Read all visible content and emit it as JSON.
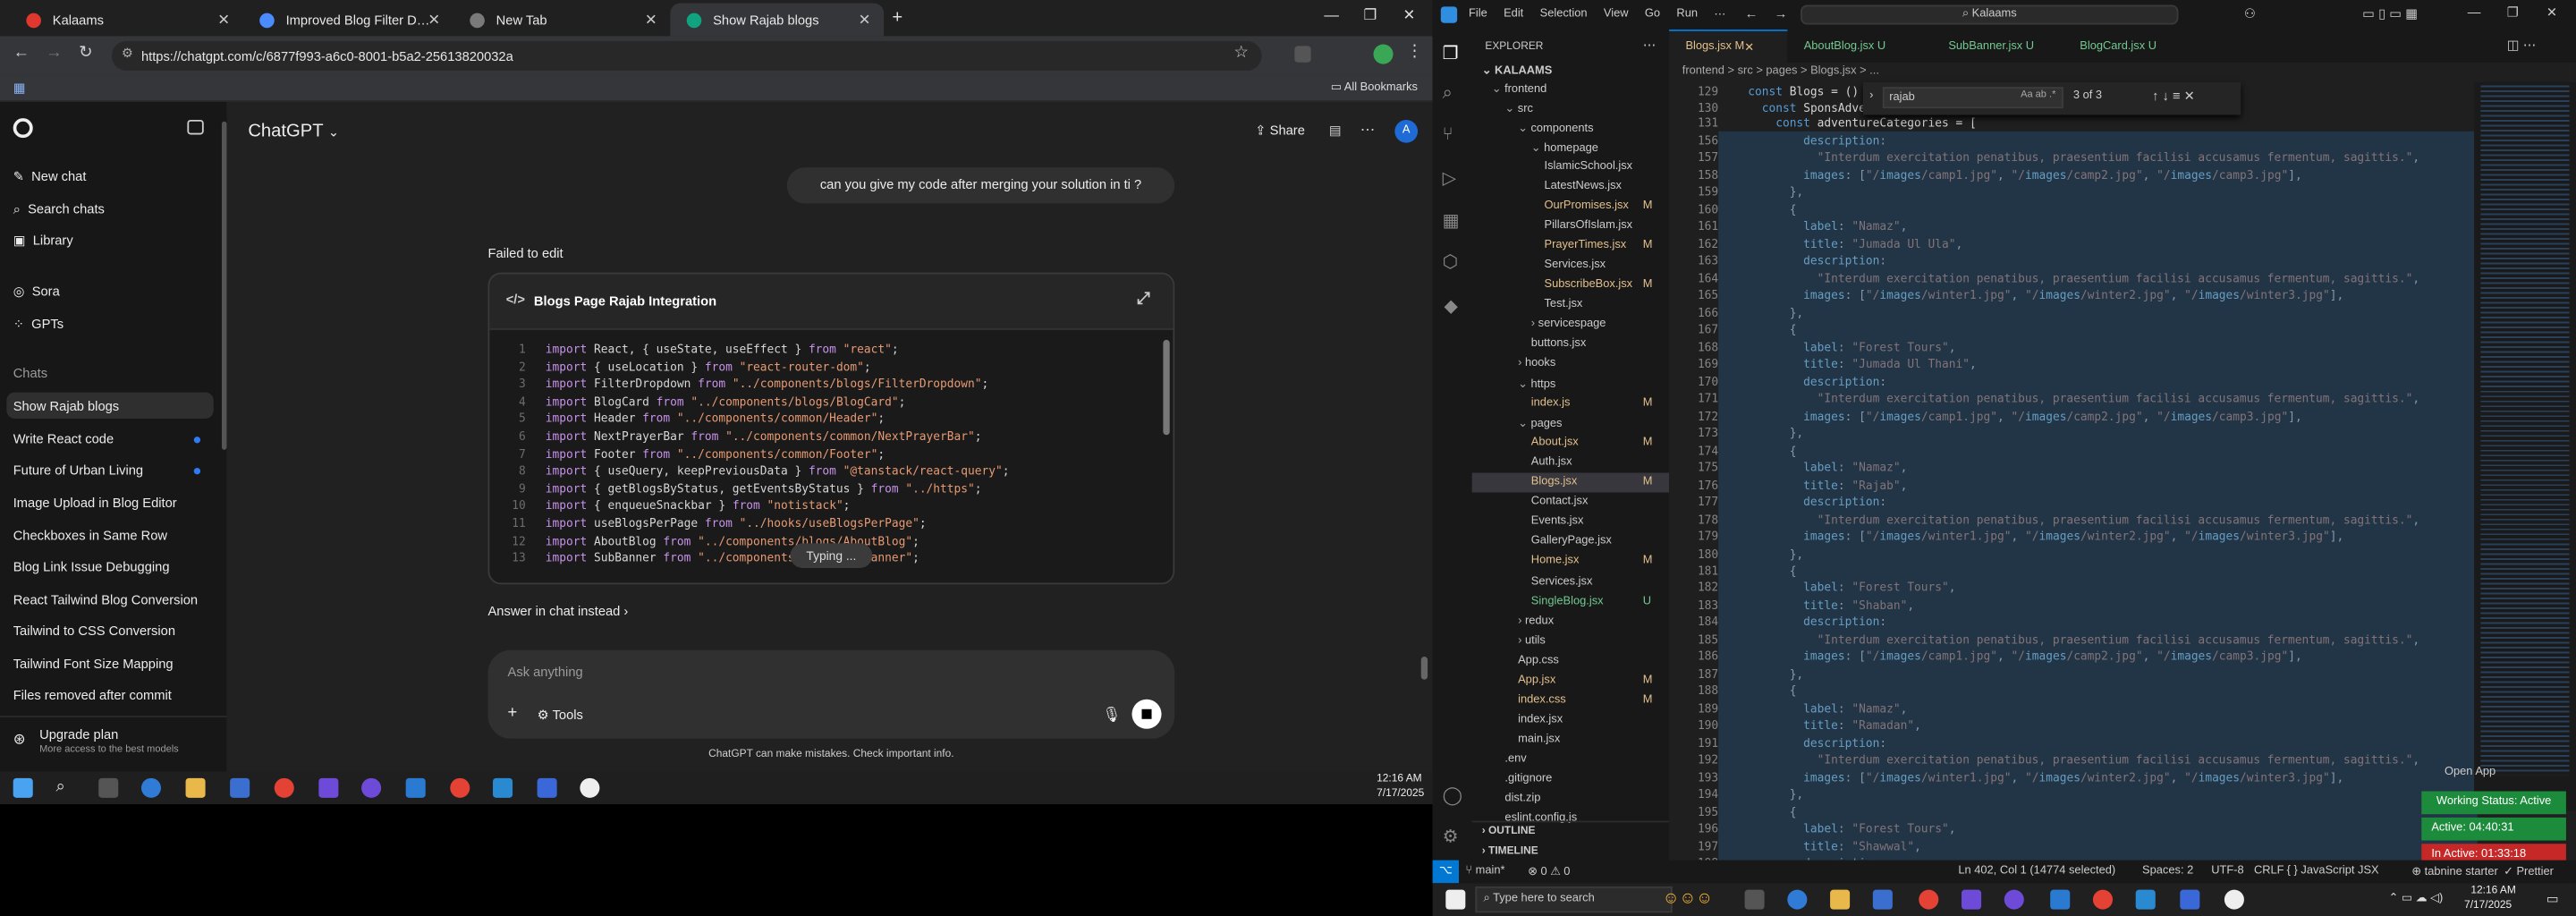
{
  "browser": {
    "tabs": [
      {
        "label": "Kalaams",
        "color": "#e0372f"
      },
      {
        "label": "Improved Blog Filter Dropdown",
        "color": "#4a8cff"
      },
      {
        "label": "New Tab",
        "color": "#7a7a7a"
      },
      {
        "label": "Show Rajab blogs",
        "color": "#10a37f"
      }
    ],
    "url": "https://chatgpt.com/c/6877f993-a6c0-8001-b5a2-25613820032a",
    "all_bookmarks": "All Bookmarks"
  },
  "chatgpt": {
    "brand": "ChatGPT",
    "share": "Share",
    "avatar": "A",
    "new_chat": "New chat",
    "search_chats": "Search chats",
    "library": "Library",
    "sora": "Sora",
    "gpts": "GPTs",
    "chats_header": "Chats",
    "chats": [
      "Show Rajab blogs",
      "Write React code",
      "Future of Urban Living",
      "Image Upload in Blog Editor",
      "Checkboxes in Same Row",
      "Blog Link Issue Debugging",
      "React Tailwind Blog Conversion",
      "Tailwind to CSS Conversion",
      "Tailwind Font Size Mapping",
      "Files removed after commit"
    ],
    "upgrade_title": "Upgrade plan",
    "upgrade_sub": "More access to the best models",
    "user_message": "can you give my code after merging your solution in ti ?",
    "failed": "Failed to edit",
    "canvas_title": "Blogs Page Rajab Integration",
    "code_lines": [
      [
        "1",
        "import React, { useState, useEffect } from \"react\";"
      ],
      [
        "2",
        "import { useLocation } from \"react-router-dom\";"
      ],
      [
        "3",
        "import FilterDropdown from \"../components/blogs/FilterDropdown\";"
      ],
      [
        "4",
        "import BlogCard from \"../components/blogs/BlogCard\";"
      ],
      [
        "5",
        "import Header from \"../components/common/Header\";"
      ],
      [
        "6",
        "import NextPrayerBar from \"../components/common/NextPrayerBar\";"
      ],
      [
        "7",
        "import Footer from \"../components/common/Footer\";"
      ],
      [
        "8",
        "import { useQuery, keepPreviousData } from \"@tanstack/react-query\";"
      ],
      [
        "9",
        "import { getBlogsByStatus, getEventsByStatus } from \"../https\";"
      ],
      [
        "10",
        "import { enqueueSnackbar } from \"notistack\";"
      ],
      [
        "11",
        "import useBlogsPerPage from \"../hooks/useBlogsPerPage\";"
      ],
      [
        "12",
        "import AboutBlog from \"../components/blogs/AboutBlog\";"
      ],
      [
        "13",
        "import SubBanner from \"../components/blogs/SubBanner\";"
      ]
    ],
    "typing": "Typing ...",
    "answer_in_chat": "Answer in chat instead",
    "input_placeholder": "Ask anything",
    "tools": "Tools",
    "disclaimer": "ChatGPT can make mistakes. Check important info."
  },
  "left_taskbar": {
    "time": "12:16 AM",
    "date": "7/17/2025"
  },
  "vscode": {
    "menu": [
      "File",
      "Edit",
      "Selection",
      "View",
      "Go",
      "Run"
    ],
    "search": "Kalaams",
    "explorer_title": "EXPLORER",
    "root": "KALAAMS",
    "tree": [
      {
        "name": "frontend",
        "indent": 1,
        "kind": "folder-open",
        "status": ""
      },
      {
        "name": "src",
        "indent": 2,
        "kind": "folder-open",
        "status": ""
      },
      {
        "name": "components",
        "indent": 3,
        "kind": "folder-open",
        "status": ""
      },
      {
        "name": "homepage",
        "indent": 4,
        "kind": "folder-open",
        "status": ""
      },
      {
        "name": "IslamicSchool.jsx",
        "indent": 5,
        "kind": "file",
        "status": ""
      },
      {
        "name": "LatestNews.jsx",
        "indent": 5,
        "kind": "file",
        "status": ""
      },
      {
        "name": "OurPromises.jsx",
        "indent": 5,
        "kind": "file",
        "status": "M"
      },
      {
        "name": "PillarsOfIslam.jsx",
        "indent": 5,
        "kind": "file",
        "status": ""
      },
      {
        "name": "PrayerTimes.jsx",
        "indent": 5,
        "kind": "file",
        "status": "M"
      },
      {
        "name": "Services.jsx",
        "indent": 5,
        "kind": "file",
        "status": ""
      },
      {
        "name": "SubscribeBox.jsx",
        "indent": 5,
        "kind": "file",
        "status": "M"
      },
      {
        "name": "Test.jsx",
        "indent": 5,
        "kind": "file",
        "status": ""
      },
      {
        "name": "servicespage",
        "indent": 4,
        "kind": "folder",
        "status": ""
      },
      {
        "name": "buttons.jsx",
        "indent": 4,
        "kind": "file",
        "status": ""
      },
      {
        "name": "hooks",
        "indent": 3,
        "kind": "folder",
        "status": ""
      },
      {
        "name": "https",
        "indent": 3,
        "kind": "folder-open",
        "status": ""
      },
      {
        "name": "index.js",
        "indent": 4,
        "kind": "file",
        "status": "M"
      },
      {
        "name": "pages",
        "indent": 3,
        "kind": "folder-open",
        "status": ""
      },
      {
        "name": "About.jsx",
        "indent": 4,
        "kind": "file",
        "status": "M"
      },
      {
        "name": "Auth.jsx",
        "indent": 4,
        "kind": "file",
        "status": ""
      },
      {
        "name": "Blogs.jsx",
        "indent": 4,
        "kind": "file",
        "status": "M"
      },
      {
        "name": "Contact.jsx",
        "indent": 4,
        "kind": "file",
        "status": ""
      },
      {
        "name": "Events.jsx",
        "indent": 4,
        "kind": "file",
        "status": ""
      },
      {
        "name": "GalleryPage.jsx",
        "indent": 4,
        "kind": "file",
        "status": ""
      },
      {
        "name": "Home.jsx",
        "indent": 4,
        "kind": "file",
        "status": "M"
      },
      {
        "name": "Services.jsx",
        "indent": 4,
        "kind": "file",
        "status": ""
      },
      {
        "name": "SingleBlog.jsx",
        "indent": 4,
        "kind": "file",
        "status": "U"
      },
      {
        "name": "redux",
        "indent": 3,
        "kind": "folder",
        "status": ""
      },
      {
        "name": "utils",
        "indent": 3,
        "kind": "folder",
        "status": ""
      },
      {
        "name": "App.css",
        "indent": 3,
        "kind": "file",
        "status": ""
      },
      {
        "name": "App.jsx",
        "indent": 3,
        "kind": "file",
        "status": "M"
      },
      {
        "name": "index.css",
        "indent": 3,
        "kind": "file",
        "status": "M"
      },
      {
        "name": "index.jsx",
        "indent": 3,
        "kind": "file",
        "status": ""
      },
      {
        "name": "main.jsx",
        "indent": 3,
        "kind": "file",
        "status": ""
      },
      {
        "name": ".env",
        "indent": 2,
        "kind": "file",
        "status": ""
      },
      {
        "name": ".gitignore",
        "indent": 2,
        "kind": "file",
        "status": ""
      },
      {
        "name": "dist.zip",
        "indent": 2,
        "kind": "file",
        "status": ""
      },
      {
        "name": "eslint.config.js",
        "indent": 2,
        "kind": "file",
        "status": ""
      }
    ],
    "outline": "OUTLINE",
    "timeline": "TIMELINE",
    "tabs": [
      {
        "label": "Blogs.jsx M",
        "active": true
      },
      {
        "label": "AboutBlog.jsx U",
        "active": false
      },
      {
        "label": "SubBanner.jsx U",
        "active": false
      },
      {
        "label": "BlogCard.jsx U",
        "active": false
      }
    ],
    "breadcrumb": "frontend > src > pages > Blogs.jsx > ...",
    "find_text": "rajab",
    "find_count": "3 of 3",
    "sticky": [
      [
        "129",
        "const Blogs = () => {"
      ],
      [
        "130",
        "  const SponsAdventure = () => {"
      ],
      [
        "131",
        "    const adventureCategories = ["
      ]
    ],
    "code": [
      [
        "156",
        "        description:"
      ],
      [
        "157",
        "          \"Interdum exercitation penatibus, praesentium facilisi accusamus fermentum, sagittis.\","
      ],
      [
        "158",
        "        images: [\"/images/camp1.jpg\", \"/images/camp2.jpg\", \"/images/camp3.jpg\"],"
      ],
      [
        "159",
        "      },"
      ],
      [
        "160",
        "      {"
      ],
      [
        "161",
        "        label: \"Namaz\","
      ],
      [
        "162",
        "        title: \"Jumada Ul Ula\","
      ],
      [
        "163",
        "        description:"
      ],
      [
        "164",
        "          \"Interdum exercitation penatibus, praesentium facilisi accusamus fermentum, sagittis.\","
      ],
      [
        "165",
        "        images: [\"/images/winter1.jpg\", \"/images/winter2.jpg\", \"/images/winter3.jpg\"],"
      ],
      [
        "166",
        "      },"
      ],
      [
        "167",
        "      {"
      ],
      [
        "168",
        "        label: \"Forest Tours\","
      ],
      [
        "169",
        "        title: \"Jumada Ul Thani\","
      ],
      [
        "170",
        "        description:"
      ],
      [
        "171",
        "          \"Interdum exercitation penatibus, praesentium facilisi accusamus fermentum, sagittis.\","
      ],
      [
        "172",
        "        images: [\"/images/camp1.jpg\", \"/images/camp2.jpg\", \"/images/camp3.jpg\"],"
      ],
      [
        "173",
        "      },"
      ],
      [
        "174",
        "      {"
      ],
      [
        "175",
        "        label: \"Namaz\","
      ],
      [
        "176",
        "        title: \"Rajab\","
      ],
      [
        "177",
        "        description:"
      ],
      [
        "178",
        "          \"Interdum exercitation penatibus, praesentium facilisi accusamus fermentum, sagittis.\","
      ],
      [
        "179",
        "        images: [\"/images/winter1.jpg\", \"/images/winter2.jpg\", \"/images/winter3.jpg\"],"
      ],
      [
        "180",
        "      },"
      ],
      [
        "181",
        "      {"
      ],
      [
        "182",
        "        label: \"Forest Tours\","
      ],
      [
        "183",
        "        title: \"Shaban\","
      ],
      [
        "184",
        "        description:"
      ],
      [
        "185",
        "          \"Interdum exercitation penatibus, praesentium facilisi accusamus fermentum, sagittis.\","
      ],
      [
        "186",
        "        images: [\"/images/camp1.jpg\", \"/images/camp2.jpg\", \"/images/camp3.jpg\"],"
      ],
      [
        "187",
        "      },"
      ],
      [
        "188",
        "      {"
      ],
      [
        "189",
        "        label: \"Namaz\","
      ],
      [
        "190",
        "        title: \"Ramadan\","
      ],
      [
        "191",
        "        description:"
      ],
      [
        "192",
        "          \"Interdum exercitation penatibus, praesentium facilisi accusamus fermentum, sagittis.\","
      ],
      [
        "193",
        "        images: [\"/images/winter1.jpg\", \"/images/winter2.jpg\", \"/images/winter3.jpg\"],"
      ],
      [
        "194",
        "      },"
      ],
      [
        "195",
        "      {"
      ],
      [
        "196",
        "        label: \"Forest Tours\","
      ],
      [
        "197",
        "        title: \"Shawwal\","
      ],
      [
        "198",
        "        description:"
      ]
    ],
    "open_app": "Open App",
    "working": "Working Status: Active",
    "active_time": "Active: 04:40:31",
    "inactive_time": "In Active: 01:33:18",
    "status": {
      "branch": "main*",
      "problems": "0 ⚠ 0",
      "position": "Ln 402, Col 1 (14774 selected)",
      "spaces": "Spaces: 2",
      "encoding": "UTF-8",
      "eol": "CRLF",
      "language": "{ } JavaScript JSX",
      "tabnine": "tabnine starter",
      "prettier": "Prettier"
    }
  },
  "taskbar": {
    "search": "Type here to search",
    "time": "12:16 AM",
    "date": "7/17/2025"
  }
}
